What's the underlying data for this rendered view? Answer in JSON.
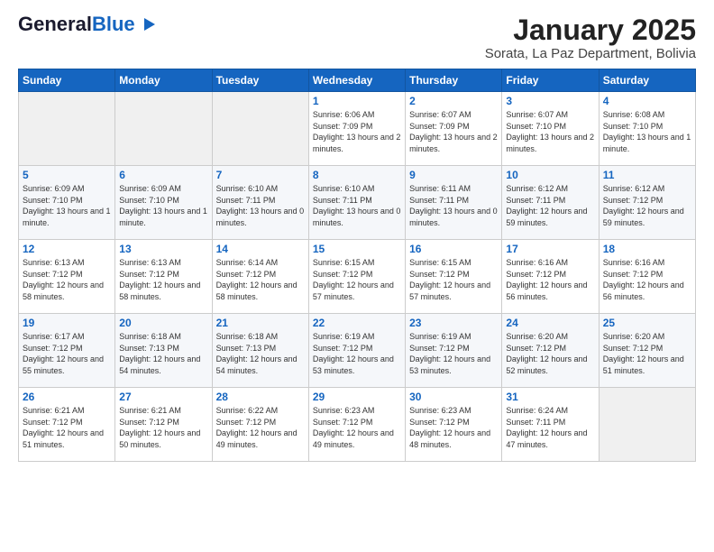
{
  "header": {
    "logo_general": "General",
    "logo_blue": "Blue",
    "month_title": "January 2025",
    "location": "Sorata, La Paz Department, Bolivia"
  },
  "days_of_week": [
    "Sunday",
    "Monday",
    "Tuesday",
    "Wednesday",
    "Thursday",
    "Friday",
    "Saturday"
  ],
  "weeks": [
    [
      {
        "day": "",
        "info": ""
      },
      {
        "day": "",
        "info": ""
      },
      {
        "day": "",
        "info": ""
      },
      {
        "day": "1",
        "info": "Sunrise: 6:06 AM\nSunset: 7:09 PM\nDaylight: 13 hours and 2 minutes."
      },
      {
        "day": "2",
        "info": "Sunrise: 6:07 AM\nSunset: 7:09 PM\nDaylight: 13 hours and 2 minutes."
      },
      {
        "day": "3",
        "info": "Sunrise: 6:07 AM\nSunset: 7:10 PM\nDaylight: 13 hours and 2 minutes."
      },
      {
        "day": "4",
        "info": "Sunrise: 6:08 AM\nSunset: 7:10 PM\nDaylight: 13 hours and 1 minute."
      }
    ],
    [
      {
        "day": "5",
        "info": "Sunrise: 6:09 AM\nSunset: 7:10 PM\nDaylight: 13 hours and 1 minute."
      },
      {
        "day": "6",
        "info": "Sunrise: 6:09 AM\nSunset: 7:10 PM\nDaylight: 13 hours and 1 minute."
      },
      {
        "day": "7",
        "info": "Sunrise: 6:10 AM\nSunset: 7:11 PM\nDaylight: 13 hours and 0 minutes."
      },
      {
        "day": "8",
        "info": "Sunrise: 6:10 AM\nSunset: 7:11 PM\nDaylight: 13 hours and 0 minutes."
      },
      {
        "day": "9",
        "info": "Sunrise: 6:11 AM\nSunset: 7:11 PM\nDaylight: 13 hours and 0 minutes."
      },
      {
        "day": "10",
        "info": "Sunrise: 6:12 AM\nSunset: 7:11 PM\nDaylight: 12 hours and 59 minutes."
      },
      {
        "day": "11",
        "info": "Sunrise: 6:12 AM\nSunset: 7:12 PM\nDaylight: 12 hours and 59 minutes."
      }
    ],
    [
      {
        "day": "12",
        "info": "Sunrise: 6:13 AM\nSunset: 7:12 PM\nDaylight: 12 hours and 58 minutes."
      },
      {
        "day": "13",
        "info": "Sunrise: 6:13 AM\nSunset: 7:12 PM\nDaylight: 12 hours and 58 minutes."
      },
      {
        "day": "14",
        "info": "Sunrise: 6:14 AM\nSunset: 7:12 PM\nDaylight: 12 hours and 58 minutes."
      },
      {
        "day": "15",
        "info": "Sunrise: 6:15 AM\nSunset: 7:12 PM\nDaylight: 12 hours and 57 minutes."
      },
      {
        "day": "16",
        "info": "Sunrise: 6:15 AM\nSunset: 7:12 PM\nDaylight: 12 hours and 57 minutes."
      },
      {
        "day": "17",
        "info": "Sunrise: 6:16 AM\nSunset: 7:12 PM\nDaylight: 12 hours and 56 minutes."
      },
      {
        "day": "18",
        "info": "Sunrise: 6:16 AM\nSunset: 7:12 PM\nDaylight: 12 hours and 56 minutes."
      }
    ],
    [
      {
        "day": "19",
        "info": "Sunrise: 6:17 AM\nSunset: 7:12 PM\nDaylight: 12 hours and 55 minutes."
      },
      {
        "day": "20",
        "info": "Sunrise: 6:18 AM\nSunset: 7:13 PM\nDaylight: 12 hours and 54 minutes."
      },
      {
        "day": "21",
        "info": "Sunrise: 6:18 AM\nSunset: 7:13 PM\nDaylight: 12 hours and 54 minutes."
      },
      {
        "day": "22",
        "info": "Sunrise: 6:19 AM\nSunset: 7:12 PM\nDaylight: 12 hours and 53 minutes."
      },
      {
        "day": "23",
        "info": "Sunrise: 6:19 AM\nSunset: 7:12 PM\nDaylight: 12 hours and 53 minutes."
      },
      {
        "day": "24",
        "info": "Sunrise: 6:20 AM\nSunset: 7:12 PM\nDaylight: 12 hours and 52 minutes."
      },
      {
        "day": "25",
        "info": "Sunrise: 6:20 AM\nSunset: 7:12 PM\nDaylight: 12 hours and 51 minutes."
      }
    ],
    [
      {
        "day": "26",
        "info": "Sunrise: 6:21 AM\nSunset: 7:12 PM\nDaylight: 12 hours and 51 minutes."
      },
      {
        "day": "27",
        "info": "Sunrise: 6:21 AM\nSunset: 7:12 PM\nDaylight: 12 hours and 50 minutes."
      },
      {
        "day": "28",
        "info": "Sunrise: 6:22 AM\nSunset: 7:12 PM\nDaylight: 12 hours and 49 minutes."
      },
      {
        "day": "29",
        "info": "Sunrise: 6:23 AM\nSunset: 7:12 PM\nDaylight: 12 hours and 49 minutes."
      },
      {
        "day": "30",
        "info": "Sunrise: 6:23 AM\nSunset: 7:12 PM\nDaylight: 12 hours and 48 minutes."
      },
      {
        "day": "31",
        "info": "Sunrise: 6:24 AM\nSunset: 7:11 PM\nDaylight: 12 hours and 47 minutes."
      },
      {
        "day": "",
        "info": ""
      }
    ]
  ]
}
